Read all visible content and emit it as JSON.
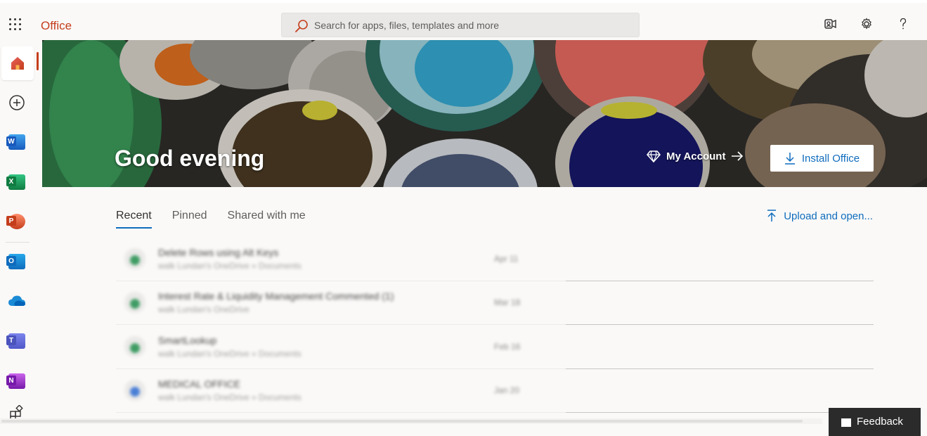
{
  "header": {
    "brand": "Office",
    "search_placeholder": "Search for apps, files, templates and more"
  },
  "hero": {
    "greeting": "Good evening",
    "my_account": "My Account",
    "install_office": "Install Office"
  },
  "rail": {
    "items": [
      {
        "name": "home",
        "letter": ""
      },
      {
        "name": "create",
        "letter": ""
      },
      {
        "name": "word",
        "letter": "W",
        "color": "#185abd"
      },
      {
        "name": "excel",
        "letter": "X",
        "color": "#107c41"
      },
      {
        "name": "powerpoint",
        "letter": "P",
        "color": "#c43e1c"
      },
      {
        "name": "outlook",
        "letter": "O",
        "color": "#0f6cbd"
      },
      {
        "name": "onedrive",
        "letter": ""
      },
      {
        "name": "teams",
        "letter": "T",
        "color": "#5b5fc7"
      },
      {
        "name": "onenote",
        "letter": "N",
        "color": "#7719aa"
      },
      {
        "name": "apps",
        "letter": ""
      }
    ]
  },
  "tabs": [
    "Recent",
    "Pinned",
    "Shared with me"
  ],
  "upload_label": "Upload and open...",
  "files": [
    {
      "name": "Delete Rows using Alt Keys",
      "path": "walk Lundan's OneDrive » Documents",
      "date": "Apr 11",
      "icon_color": "#3f9c64"
    },
    {
      "name": "Interest Rate & Liquidity Management Commented (1)",
      "path": "walk Lundan's OneDrive",
      "date": "Mar 18",
      "icon_color": "#3f9c64"
    },
    {
      "name": "SmartLookup",
      "path": "walk Lundan's OneDrive » Documents",
      "date": "Feb 16",
      "icon_color": "#3f9c64"
    },
    {
      "name": "MEDICAL OFFICE",
      "path": "walk Lundan's OneDrive » Documents",
      "date": "Jan 20",
      "icon_color": "#4a7fd6"
    }
  ],
  "feedback_label": "Feedback",
  "colors": {
    "accent": "#0f6cbd",
    "brand": "#c43e1c"
  }
}
